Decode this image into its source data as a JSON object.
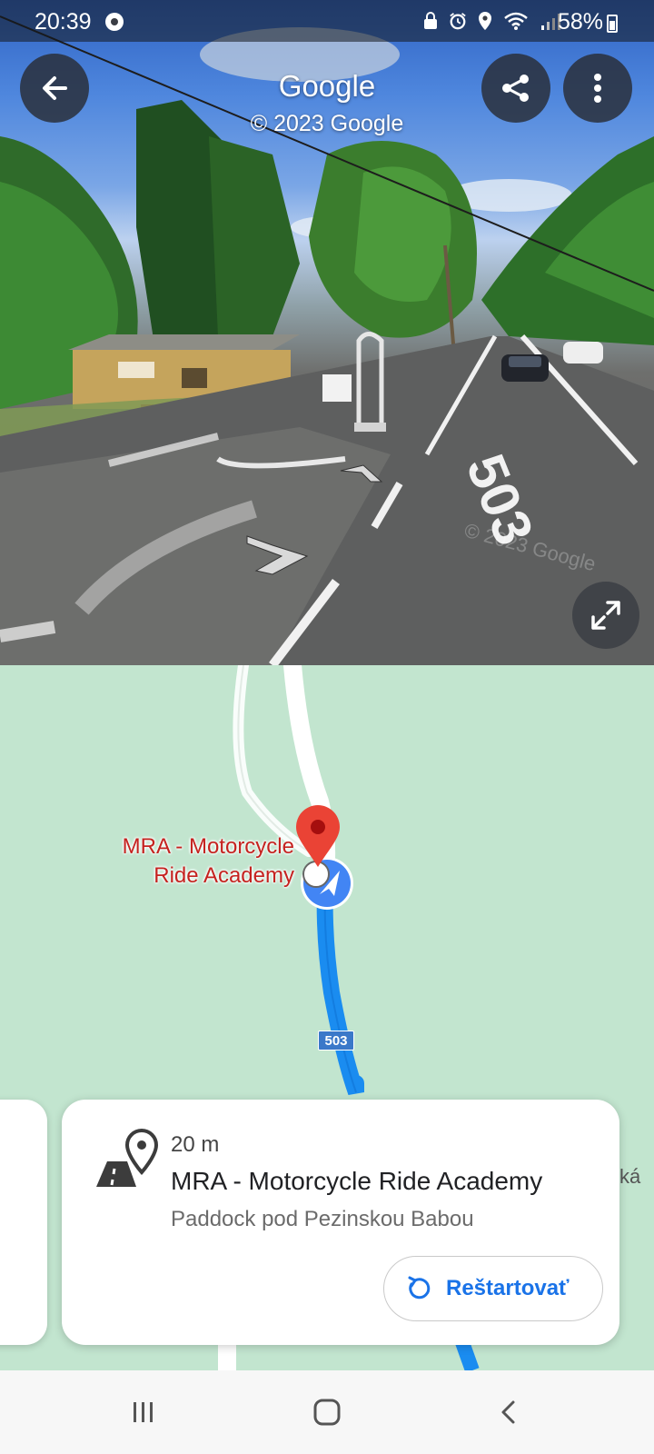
{
  "status_bar": {
    "time": "20:39",
    "battery": "58%",
    "icons": [
      "chrome-icon",
      "lock-icon",
      "alarm-icon",
      "location-icon",
      "wifi-icon",
      "signal-icon",
      "battery-icon"
    ]
  },
  "street_view": {
    "title": "Google",
    "copyright": "© 2023 Google",
    "road_number": "503",
    "watermark": "© 2023 Google",
    "back_icon": "arrow-back-icon",
    "share_icon": "share-icon",
    "more_icon": "more-vert-icon",
    "expand_icon": "expand-icon"
  },
  "map": {
    "place_label": "MRA - Motorcycle Ride Academy",
    "route_badge": "503",
    "edge_text": "ká",
    "colors": {
      "land": "#c2e5cf",
      "route": "#1a8cf0",
      "pin": "#ea4335"
    }
  },
  "card": {
    "distance": "20 m",
    "title": "MRA - Motorcycle Ride Academy",
    "subtitle": "Paddock pod Pezinskou Babou",
    "restart_label": "Reštartovať",
    "icon": "racetrack-pin-icon",
    "accent": "#1a73e8"
  },
  "nav_bar": {
    "recent_icon": "recent-apps-icon",
    "home_icon": "home-icon",
    "back_icon": "nav-back-icon"
  }
}
